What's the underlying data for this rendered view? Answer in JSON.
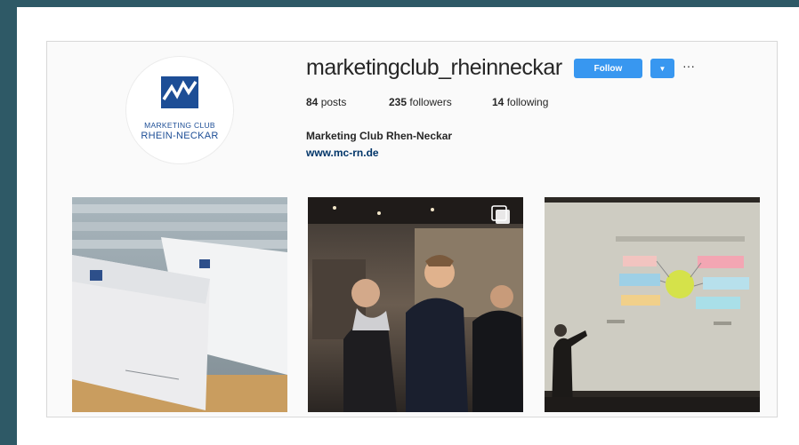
{
  "profile": {
    "username": "marketingclub_rheinneckar",
    "follow_label": "Follow",
    "more_label": "···",
    "posts_count": "84",
    "posts_label": "posts",
    "followers_count": "235",
    "followers_label": "followers",
    "following_count": "14",
    "following_label": "following",
    "full_name": "Marketing Club Rhen-Neckar",
    "website": "www.mc-rn.de"
  },
  "avatar": {
    "logo_line1": "MARKETING CLUB",
    "logo_line2": "RHEIN-NECKAR",
    "brand_color": "#1d4e96"
  },
  "posts": [
    {
      "name": "post-1",
      "subject": "marketing club envelopes and stationery"
    },
    {
      "name": "post-2",
      "subject": "networking event photo",
      "multi_icon": "multiple-photos-icon"
    },
    {
      "name": "post-3",
      "subject": "presentation on projector screen"
    }
  ],
  "colors": {
    "follow_button": "#3897f0",
    "link": "#003569",
    "background": "#2e5966"
  }
}
